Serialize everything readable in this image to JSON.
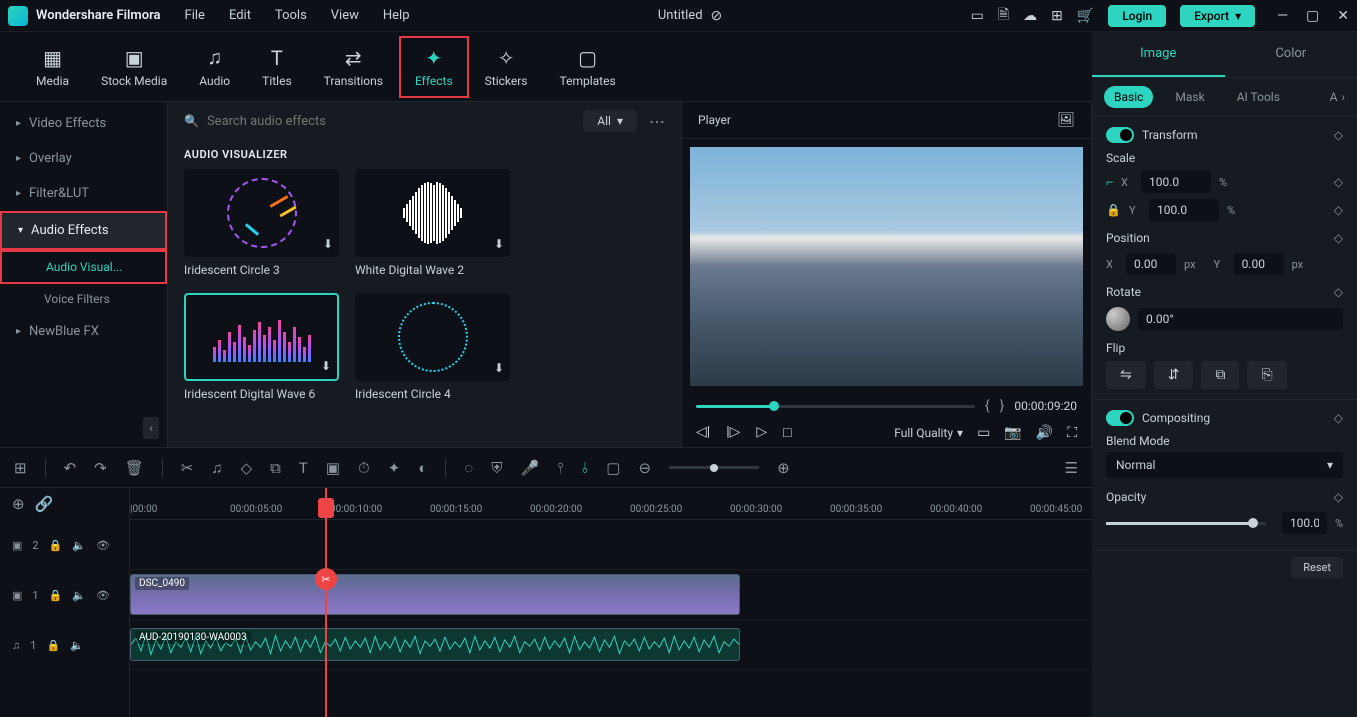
{
  "app": {
    "name": "Wondershare Filmora"
  },
  "menus": [
    "File",
    "Edit",
    "Tools",
    "View",
    "Help"
  ],
  "document": {
    "title": "Untitled"
  },
  "auth": {
    "login": "Login",
    "export": "Export"
  },
  "tabs": [
    "Media",
    "Stock Media",
    "Audio",
    "Titles",
    "Transitions",
    "Effects",
    "Stickers",
    "Templates"
  ],
  "sidebar": {
    "items": [
      "Video Effects",
      "Overlay",
      "Filter&LUT",
      "Audio Effects",
      "NewBlue FX"
    ],
    "subs": [
      "Audio Visual...",
      "Voice Filters"
    ]
  },
  "search": {
    "placeholder": "Search audio effects",
    "filter": "All"
  },
  "section_title": "AUDIO VISUALIZER",
  "effects": [
    {
      "name": "Iridescent Circle 3"
    },
    {
      "name": "White  Digital Wave 2"
    },
    {
      "name": "Iridescent Digital Wave 6"
    },
    {
      "name": "Iridescent Circle 4"
    }
  ],
  "player": {
    "title": "Player",
    "timecode": "00:00:09:20",
    "quality": "Full Quality"
  },
  "props": {
    "tabs": [
      "Image",
      "Color"
    ],
    "subtabs": [
      "Basic",
      "Mask",
      "AI Tools",
      "A"
    ],
    "transform": "Transform",
    "scale": "Scale",
    "scale_x": "100.0",
    "scale_y": "100.0",
    "pct": "%",
    "position": "Position",
    "pos_x": "0.00",
    "pos_y": "0.00",
    "px": "px",
    "rotate": "Rotate",
    "rotate_val": "0.00°",
    "flip": "Flip",
    "compositing": "Compositing",
    "blend_mode": "Blend Mode",
    "blend_val": "Normal",
    "opacity": "Opacity",
    "opacity_val": "100.0",
    "reset": "Reset",
    "x": "X",
    "y": "Y"
  },
  "timeline": {
    "marks": [
      "|00:00",
      "00:00:05:00",
      "00:00:10:00",
      "00:00:15:00",
      "00:00:20:00",
      "00:00:25:00",
      "00:00:30:00",
      "00:00:35:00",
      "00:00:40:00",
      "00:00:45:00"
    ],
    "tracks": [
      {
        "id": "2",
        "type": "video"
      },
      {
        "id": "1",
        "type": "video"
      },
      {
        "id": "1",
        "type": "audio"
      }
    ],
    "video_clip": "DSC_0490",
    "audio_clip": "AUD-20190130-WA0003"
  }
}
